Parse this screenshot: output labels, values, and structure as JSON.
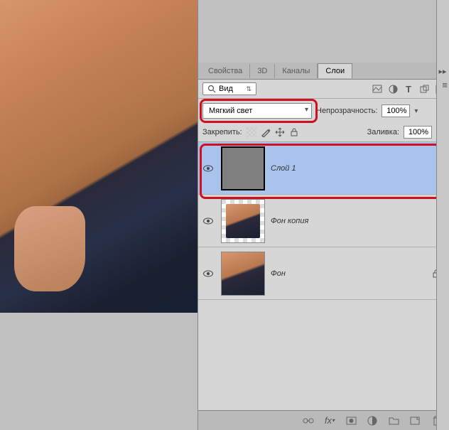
{
  "tabs": {
    "properties": "Свойства",
    "threeD": "3D",
    "channels": "Каналы",
    "layers": "Слои"
  },
  "filter": {
    "label": "Вид"
  },
  "blend": {
    "mode": "Мягкий свет"
  },
  "opacity": {
    "label": "Непрозрачность:",
    "value": "100%"
  },
  "lock": {
    "label": "Закрепить:"
  },
  "fill": {
    "label": "Заливка:",
    "value": "100%"
  },
  "layers": [
    {
      "name": "Слой 1",
      "selected": true,
      "visible": true,
      "thumb": "gray"
    },
    {
      "name": "Фон копия",
      "selected": false,
      "visible": true,
      "thumb": "checker"
    },
    {
      "name": "Фон",
      "selected": false,
      "visible": true,
      "thumb": "photo",
      "locked": true
    }
  ],
  "icons": {
    "search": "○",
    "expand": "▸▸",
    "menu": "≡"
  }
}
